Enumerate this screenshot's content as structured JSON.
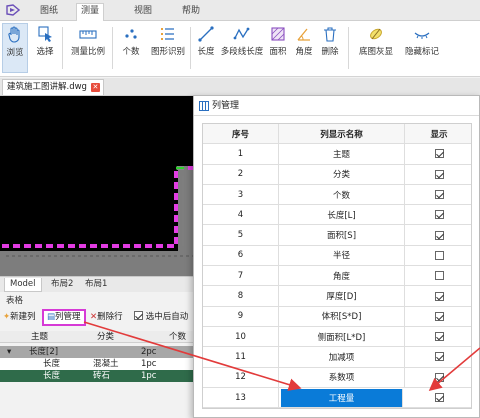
{
  "tabs": [
    {
      "label": "图纸",
      "active": false
    },
    {
      "label": "测量",
      "active": true
    },
    {
      "label": "视图",
      "active": false
    },
    {
      "label": "帮助",
      "active": false
    }
  ],
  "toolbar": {
    "browse": "浏览",
    "select": "选择",
    "measure_scale": "测量比例",
    "count": "个数",
    "shape_recognize": "图形识别",
    "length": "长度",
    "polyline_length": "多段线长度",
    "area": "面积",
    "angle": "角度",
    "delete": "删除",
    "base_gray": "底图灰显",
    "hide_marks": "隐藏标记"
  },
  "file_tab": "建筑施工图讲解.dwg",
  "model_tabs": [
    "Model",
    "布局2",
    "布局1"
  ],
  "table_panel": {
    "title": "表格",
    "new_column": "新建列",
    "column_manage": "列管理",
    "delete_row": "删除行",
    "auto_label": "选中后自动",
    "headers": [
      "主题",
      "分类",
      "个数"
    ],
    "rows": [
      {
        "c0": "长度[2]",
        "c1": "",
        "c2": "2pc"
      },
      {
        "c0": "长度",
        "c1": "混凝土",
        "c2": "1pc"
      },
      {
        "c0": "长度",
        "c1": "砖石",
        "c2": "1pc"
      }
    ]
  },
  "dialog": {
    "title": "列管理",
    "headers": {
      "index": "序号",
      "name": "列显示名称",
      "show": "显示"
    },
    "rows": [
      {
        "index": "1",
        "name": "主题",
        "checked": true
      },
      {
        "index": "2",
        "name": "分类",
        "checked": true
      },
      {
        "index": "3",
        "name": "个数",
        "checked": true
      },
      {
        "index": "4",
        "name": "长度[L]",
        "checked": true
      },
      {
        "index": "5",
        "name": "面积[S]",
        "checked": true
      },
      {
        "index": "6",
        "name": "半径",
        "checked": false
      },
      {
        "index": "7",
        "name": "角度",
        "checked": false
      },
      {
        "index": "8",
        "name": "厚度[D]",
        "checked": true
      },
      {
        "index": "9",
        "name": "体积[S*D]",
        "checked": true
      },
      {
        "index": "10",
        "name": "侧面积[L*D]",
        "checked": true
      },
      {
        "index": "11",
        "name": "加减项",
        "checked": true
      },
      {
        "index": "12",
        "name": "系数项",
        "checked": true
      },
      {
        "index": "13",
        "name": "工程量",
        "checked": true
      }
    ]
  },
  "colors": {
    "accent": "#0a7bd8",
    "highlight": "#d63ad6",
    "arrow": "#e23b3b",
    "row_selected": "#2f6b4a"
  }
}
